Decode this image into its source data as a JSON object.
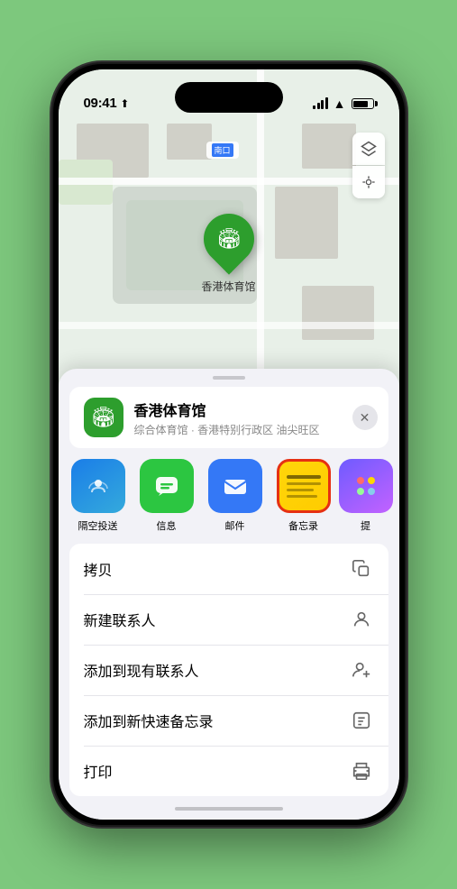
{
  "status_bar": {
    "time": "09:41",
    "location_arrow": "▶"
  },
  "map": {
    "south_label": "南口",
    "pin_label": "香港体育馆",
    "pin_emoji": "🏟"
  },
  "map_controls": {
    "layers_icon": "🗺",
    "location_icon": "◎"
  },
  "venue": {
    "name": "香港体育馆",
    "subtitle": "综合体育馆 · 香港特别行政区 油尖旺区",
    "icon_emoji": "🏟"
  },
  "share_items": [
    {
      "id": "airdrop",
      "label": "隔空投送",
      "icon_type": "airdrop"
    },
    {
      "id": "messages",
      "label": "信息",
      "icon_type": "messages"
    },
    {
      "id": "mail",
      "label": "邮件",
      "icon_type": "mail"
    },
    {
      "id": "notes",
      "label": "备忘录",
      "icon_type": "notes"
    },
    {
      "id": "more",
      "label": "提",
      "icon_type": "more"
    }
  ],
  "actions": [
    {
      "id": "copy",
      "label": "拷贝",
      "icon": "⎘"
    },
    {
      "id": "new-contact",
      "label": "新建联系人",
      "icon": "👤"
    },
    {
      "id": "add-existing",
      "label": "添加到现有联系人",
      "icon": "👤+"
    },
    {
      "id": "add-notes",
      "label": "添加到新快速备忘录",
      "icon": "📋"
    },
    {
      "id": "print",
      "label": "打印",
      "icon": "🖨"
    }
  ]
}
